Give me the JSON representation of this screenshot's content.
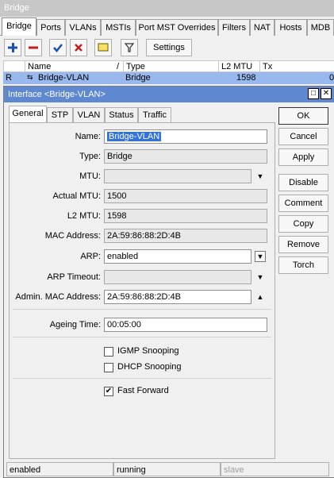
{
  "window": {
    "title": "Bridge"
  },
  "outer_tabs": [
    "Bridge",
    "Ports",
    "VLANs",
    "MSTIs",
    "Port MST Overrides",
    "Filters",
    "NAT",
    "Hosts",
    "MDB"
  ],
  "toolbar": {
    "settings_label": "Settings",
    "icons": [
      "add-icon",
      "remove-icon",
      "enable-check-icon",
      "disable-x-icon",
      "comment-icon",
      "filter-icon"
    ]
  },
  "table": {
    "columns": [
      "Name",
      "Type",
      "L2 MTU",
      "Tx"
    ],
    "sort_marker": "/",
    "row": {
      "flag": "R",
      "name": "Bridge-VLAN",
      "type": "Bridge",
      "l2mtu": "1598",
      "tx": "0"
    }
  },
  "dialog": {
    "title": "Interface <Bridge-VLAN>",
    "tabs": [
      "General",
      "STP",
      "VLAN",
      "Status",
      "Traffic"
    ],
    "fields": {
      "name": {
        "label": "Name:",
        "value": "Bridge-VLAN"
      },
      "type": {
        "label": "Type:",
        "value": "Bridge"
      },
      "mtu": {
        "label": "MTU:",
        "value": ""
      },
      "actual_mtu": {
        "label": "Actual MTU:",
        "value": "1500"
      },
      "l2_mtu": {
        "label": "L2 MTU:",
        "value": "1598"
      },
      "mac": {
        "label": "MAC Address:",
        "value": "2A:59:86:88:2D:4B"
      },
      "arp": {
        "label": "ARP:",
        "value": "enabled"
      },
      "arp_timeout": {
        "label": "ARP Timeout:",
        "value": ""
      },
      "admin_mac": {
        "label": "Admin. MAC Address:",
        "value": "2A:59:86:88:2D:4B"
      },
      "ageing": {
        "label": "Ageing Time:",
        "value": "00:05:00"
      }
    },
    "checkboxes": {
      "igmp": {
        "label": "IGMP Snooping",
        "checked": false
      },
      "dhcp": {
        "label": "DHCP Snooping",
        "checked": false
      },
      "fast_forward": {
        "label": "Fast Forward",
        "checked": true,
        "mark": "✔"
      }
    },
    "buttons": [
      "OK",
      "Cancel",
      "Apply",
      "Disable",
      "Comment",
      "Copy",
      "Remove",
      "Torch"
    ],
    "status": [
      "enabled",
      "running",
      "slave"
    ]
  }
}
